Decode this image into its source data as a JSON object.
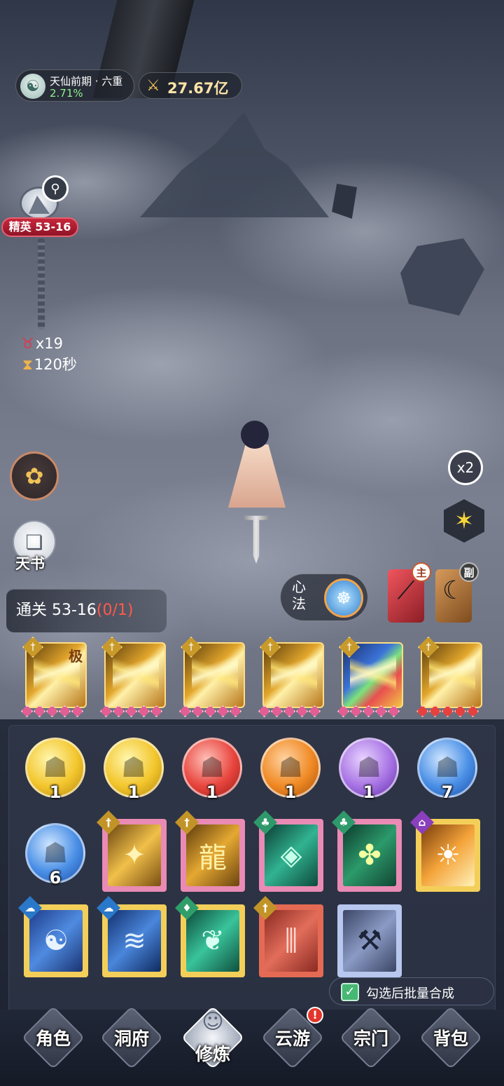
{
  "status": {
    "realm_name": "天仙前期 · 六重",
    "realm_progress": "2.71%",
    "combat_power": "27.67亿"
  },
  "stage": {
    "tag": "精英 53-16",
    "enemy_count": "x19",
    "timer": "120秒"
  },
  "side": {
    "book_label": "天书",
    "speed_label": "x2"
  },
  "objective": {
    "label": "通关 53-16",
    "progress": "(0/1)"
  },
  "xinfa": {
    "label": "心法"
  },
  "weapons": {
    "main_badge": "主",
    "sub_badge": "副"
  },
  "skills": [
    {
      "tier": "极",
      "stars": 5,
      "type_icon": "sword-icon"
    },
    {
      "tier": "",
      "stars": 5,
      "type_icon": "sword-icon"
    },
    {
      "tier": "",
      "stars": 5,
      "type_icon": "sword-icon"
    },
    {
      "tier": "",
      "stars": 5,
      "type_icon": "sword-icon"
    },
    {
      "tier": "",
      "stars": 5,
      "type_icon": "sword-icon"
    },
    {
      "tier": "",
      "stars": 5,
      "type_icon": "sword-icon"
    }
  ],
  "orbs": [
    {
      "color": "#f3c62d",
      "count": "1"
    },
    {
      "color": "#f3c62d",
      "count": "1"
    },
    {
      "color": "#e8463e",
      "count": "1"
    },
    {
      "color": "#f08a25",
      "count": "1"
    },
    {
      "color": "#a874e4",
      "count": "1"
    },
    {
      "color": "#4a8fe6",
      "count": "7"
    },
    {
      "color": "#4a8fe6",
      "count": "6"
    }
  ],
  "cards": [
    {
      "frame": "pink",
      "tag_color": "gold",
      "icon": "golden-slash-icon"
    },
    {
      "frame": "pink",
      "tag_color": "gold",
      "icon": "golden-dragon-icon"
    },
    {
      "frame": "pink",
      "tag_color": "green",
      "icon": "jade-beast-icon"
    },
    {
      "frame": "pink",
      "tag_color": "green",
      "icon": "talisman-swarm-icon"
    },
    {
      "frame": "gold",
      "tag_color": "purple",
      "icon": "sunburst-icon"
    },
    {
      "frame": "gold",
      "tag_color": "cyan",
      "icon": "taiji-icon"
    },
    {
      "frame": "gold",
      "tag_color": "cyan",
      "icon": "wind-blade-icon"
    },
    {
      "frame": "gold",
      "tag_color": "teal",
      "icon": "jade-leaf-icon"
    },
    {
      "frame": "red",
      "tag_color": "gold",
      "icon": "triple-sword-icon"
    },
    {
      "frame": "blue",
      "tag_color": "",
      "icon": "blade-hilt-icon"
    }
  ],
  "batch": {
    "label": "勾选后批量合成",
    "checked": true
  },
  "nav": [
    {
      "label": "角色"
    },
    {
      "label": "洞府"
    },
    {
      "label": "修炼"
    },
    {
      "label": "云游"
    },
    {
      "label": "宗门"
    },
    {
      "label": "背包"
    }
  ],
  "nav_alert": "!"
}
